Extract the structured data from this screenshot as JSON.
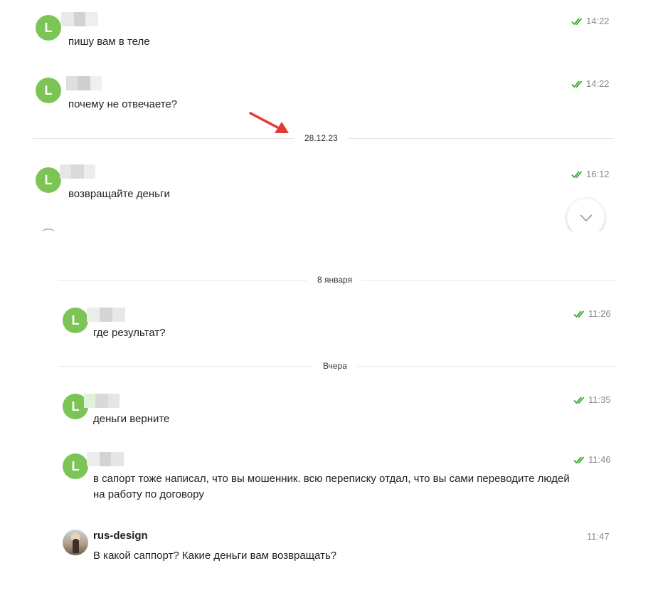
{
  "top_panel": {
    "messages": [
      {
        "avatar_letter": "L",
        "time": "14:22",
        "text": "пишу вам в теле"
      },
      {
        "avatar_letter": "L",
        "time": "14:22",
        "text": "почему не отвечаете?"
      },
      {
        "avatar_letter": "L",
        "time": "16:12",
        "text": "возвращайте деньги"
      }
    ],
    "date_divider": "28.12.23"
  },
  "bottom_panel": {
    "dividers": [
      "8 января",
      "Вчера"
    ],
    "messages": [
      {
        "avatar_letter": "L",
        "time": "11:26",
        "text": "где результат?"
      },
      {
        "avatar_letter": "L",
        "time": "11:35",
        "text": "деньги верните"
      },
      {
        "avatar_letter": "L",
        "time": "11:46",
        "text": "в сапорт тоже написал, что вы мошенник. всю переписку отдал, что вы сами переводите людей на работу по договору"
      },
      {
        "sender": "rus-design",
        "time": "11:47",
        "text": "В какой саппорт? Какие деньги вам возвращать?"
      }
    ]
  },
  "icons": {
    "read_check": "double-check-icon",
    "annotation_arrow": "red-arrow-icon",
    "scroll_down": "chevron-down-icon"
  },
  "colors": {
    "avatar_green": "#7cc455",
    "check_green": "#3aa832",
    "arrow_red": "#e53935"
  }
}
